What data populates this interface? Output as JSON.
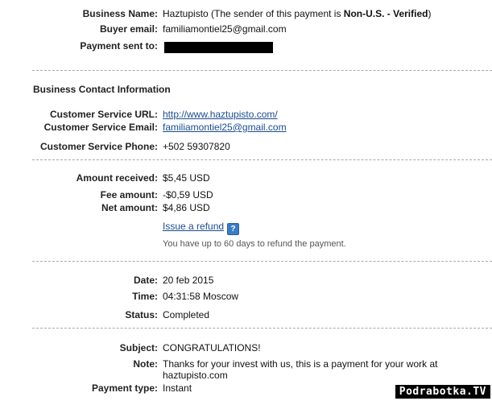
{
  "business": {
    "name_label": "Business Name:",
    "name_value": "Haztupisto",
    "sender_note_pre": " (The sender of this payment is ",
    "sender_status": "Non-U.S. - Verified",
    "sender_note_post": ")",
    "buyer_email_label": "Buyer email:",
    "buyer_email_value": "familiamontiel25@gmail.com",
    "payment_sent_label": "Payment sent to:"
  },
  "contact": {
    "section_title": "Business Contact Information",
    "url_label": "Customer Service URL:",
    "url_value": "http://www.haztupisto.com/",
    "email_label": "Customer Service Email:",
    "email_value": "familiamontiel25@gmail.com",
    "phone_label": "Customer Service Phone:",
    "phone_value": "+502 59307820"
  },
  "amounts": {
    "received_label": "Amount received:",
    "received_value": "$5,45 USD",
    "fee_label": "Fee amount:",
    "fee_value": "-$0,59 USD",
    "net_label": "Net amount:",
    "net_value": "$4,86 USD",
    "refund_link": "Issue a refund",
    "help_icon": "?",
    "refund_note": "You have up to 60 days to refund the payment."
  },
  "details": {
    "date_label": "Date:",
    "date_value": "20 feb 2015",
    "time_label": "Time:",
    "time_value": "04:31:58 Moscow",
    "status_label": "Status:",
    "status_value": "Completed"
  },
  "message": {
    "subject_label": "Subject:",
    "subject_value": "CONGRATULATIONS!",
    "note_label": "Note:",
    "note_line1": "Thanks for your invest with us, this is a payment for your work at",
    "note_line2": "haztupisto.com",
    "payment_type_label": "Payment type:",
    "payment_type_value": "Instant"
  },
  "watermark": "Podrabotka.TV",
  "colors": {
    "link": "#1a4c8f",
    "help_icon": "#3b7dc4",
    "separator": "#a8a8a8"
  }
}
